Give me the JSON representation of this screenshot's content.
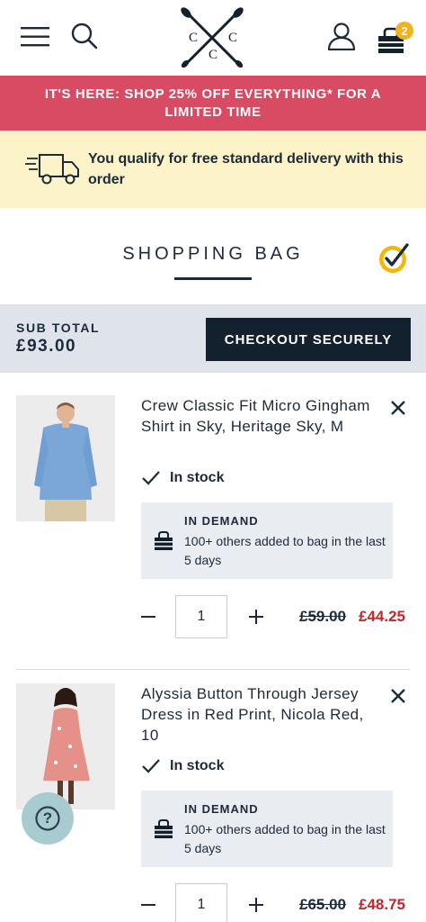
{
  "header": {
    "menu_icon": "hamburger-menu-icon",
    "search_icon": "search-icon",
    "logo": {
      "letters": [
        "C",
        "C",
        "C"
      ],
      "description_icon": "crossed-oars-logo"
    },
    "account_icon": "user-icon",
    "bag_icon": "shopping-bag-icon",
    "bag_count": "2"
  },
  "promo": {
    "text": "IT'S HERE: SHOP 25% OFF EVERYTHING* FOR A LIMITED TIME"
  },
  "delivery": {
    "icon": "fast-delivery-truck-icon",
    "text": "You qualify for free standard delivery with this order"
  },
  "page": {
    "title": "SHOPPING BAG",
    "security_badge_icon": "norton-check-icon"
  },
  "summary": {
    "subtotal_label": "SUB TOTAL",
    "subtotal_value": "£93.00",
    "checkout_label": "CHECKOUT SECURELY"
  },
  "items": [
    {
      "name": "Crew Classic Fit Micro Gingham Shirt in Sky, Heritage Sky, M",
      "stock": "In stock",
      "demand_title": "IN DEMAND",
      "demand_text": "100+ others added to bag in the last 5 days",
      "quantity": "1",
      "price_old": "£59.00",
      "price_new": "£44.25"
    },
    {
      "name": "Alyssia Button Through Jersey Dress in Red Print, Nicola Red, 10",
      "stock": "In stock",
      "demand_title": "IN DEMAND",
      "demand_text": "100+ others added to bag in the last 5 days",
      "quantity": "1",
      "price_old": "£65.00",
      "price_new": "£48.75"
    }
  ],
  "help": {
    "label": "?",
    "icon": "help-question-icon"
  },
  "colors": {
    "promo": "#d94b63",
    "delivery_bg": "#fdf3c8",
    "navy": "#13202e",
    "sale_red": "#c1272d",
    "badge": "#f2b21b"
  }
}
